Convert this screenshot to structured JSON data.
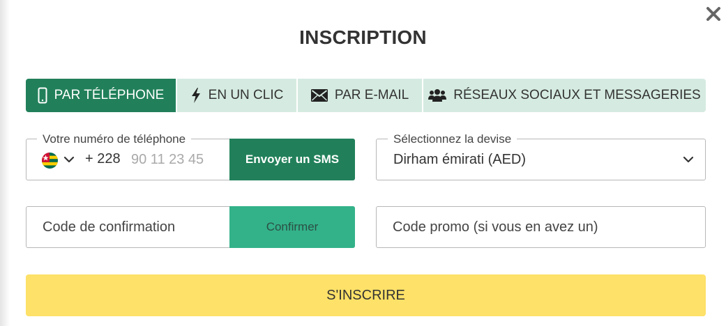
{
  "modal": {
    "title": "INSCRIPTION",
    "close_icon": "close-icon"
  },
  "tabs": [
    {
      "label": "PAR TÉLÉPHONE",
      "icon": "mobile-phone-icon",
      "active": true
    },
    {
      "label": "EN UN CLIC",
      "icon": "lightning-bolt-icon",
      "active": false
    },
    {
      "label": "PAR E-MAIL",
      "icon": "envelope-icon",
      "active": false
    },
    {
      "label": "RÉSEAUX SOCIAUX ET MESSAGERIES",
      "icon": "users-icon",
      "active": false
    }
  ],
  "phone": {
    "legend": "Votre numéro de téléphone",
    "country_flag": "togo-flag-icon",
    "dial_code": "+ 228",
    "placeholder": "90 11 23 45",
    "value": "",
    "sms_button": "Envoyer un SMS"
  },
  "currency": {
    "legend": "Sélectionnez la devise",
    "selected": "Dirham émirati (AED)"
  },
  "confirmation": {
    "placeholder": "Code de confirmation",
    "button": "Confirmer"
  },
  "promo": {
    "placeholder": "Code promo (si vous en avez un)"
  },
  "submit": {
    "label": "S'INSCRIRE"
  },
  "colors": {
    "primary_green": "#21805a",
    "tab_inactive_bg": "#d5ebe1",
    "confirm_green": "#33b289",
    "submit_yellow": "#fde168",
    "text": "#333333"
  }
}
